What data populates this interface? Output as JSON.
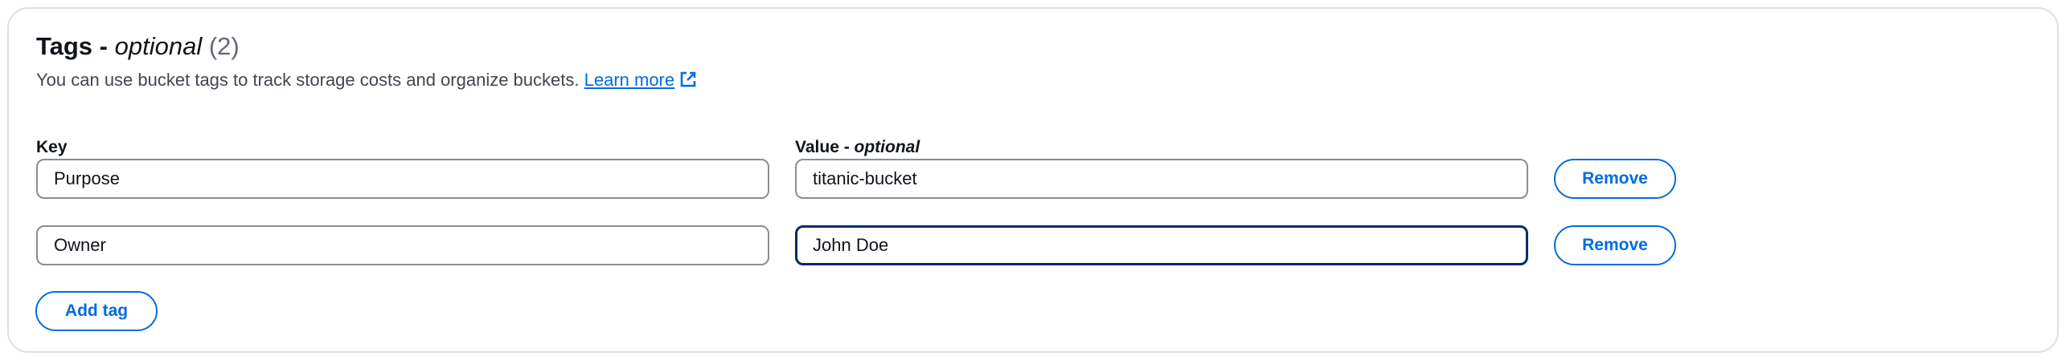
{
  "section": {
    "title_main": "Tags - ",
    "title_optional": "optional",
    "title_count": "(2)",
    "description": "You can use bucket tags to track storage costs and organize buckets.",
    "learn_more": "Learn more"
  },
  "columns": {
    "key_label": "Key",
    "value_label_main": "Value - ",
    "value_label_optional": "optional"
  },
  "tags": [
    {
      "key": "Purpose",
      "value": "titanic-bucket",
      "remove_label": "Remove"
    },
    {
      "key": "Owner",
      "value": "John Doe",
      "remove_label": "Remove"
    }
  ],
  "add_tag_label": "Add tag",
  "colors": {
    "accent": "#006ce0",
    "focus_border": "#002b66",
    "input_border": "#8c8c94",
    "panel_border": "#dcdfe3"
  },
  "icons": {
    "learn_more": "external-link-icon"
  }
}
